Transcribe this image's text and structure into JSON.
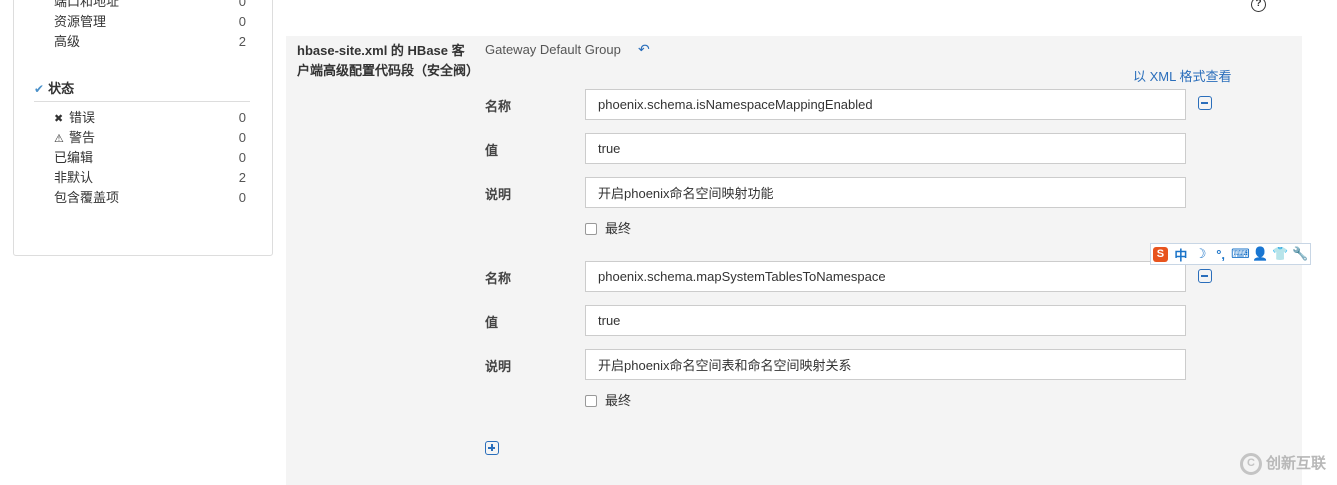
{
  "sidebar": {
    "top_items": [
      {
        "label": "端口和地址",
        "count": "0"
      },
      {
        "label": "资源管理",
        "count": "0"
      },
      {
        "label": "高级",
        "count": "2"
      }
    ],
    "status_section": {
      "title": "状态",
      "items": [
        {
          "label": "错误",
          "count": "0",
          "icon": "error-icon"
        },
        {
          "label": "警告",
          "count": "0",
          "icon": "warning-icon"
        },
        {
          "label": "已编辑",
          "count": "0"
        },
        {
          "label": "非默认",
          "count": "2"
        },
        {
          "label": "包含覆盖项",
          "count": "0"
        }
      ]
    }
  },
  "help_icon": "?",
  "property": {
    "title": "hbase-site.xml 的 HBase 客户端高级配置代码段（安全阀）",
    "group": "Gateway Default Group",
    "xml_link": "以 XML 格式查看",
    "entries": [
      {
        "name_label": "名称",
        "name_value": "phoenix.schema.isNamespaceMappingEnabled",
        "value_label": "值",
        "value_value": "true",
        "desc_label": "说明",
        "desc_value": "开启phoenix命名空间映射功能",
        "final_label": "最终"
      },
      {
        "name_label": "名称",
        "name_value": "phoenix.schema.mapSystemTablesToNamespace",
        "value_label": "值",
        "value_value": "true",
        "desc_label": "说明",
        "desc_value": "开启phoenix命名空间表和命名空间映射关系",
        "final_label": "最终"
      }
    ]
  },
  "ime_toolbar": {
    "logo": "S",
    "lang": "中",
    "items": [
      "☽",
      "°,",
      "⌨",
      "👤",
      "👕",
      "🔧"
    ]
  },
  "watermark": {
    "text": "创新互联"
  },
  "colors": {
    "link": "#2a6ebb",
    "panel_bg": "#f4f4f4"
  }
}
